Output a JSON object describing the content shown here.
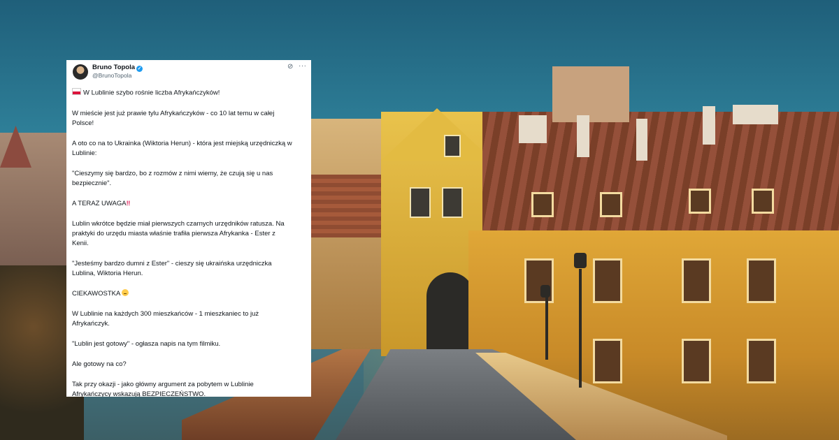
{
  "tweet": {
    "display_name": "Bruno Topola",
    "handle": "@BrunoTopola",
    "paragraphs": [
      "W Lublinie szybo rośnie liczba Afrykańczyków!",
      "W mieście jest już prawie tylu Afrykańczyków - co 10 lat temu w całej Polsce!",
      "A oto co na to Ukrainka (Wiktoria Herun) - która jest miejską urzędniczką w Lublinie:",
      "\"Cieszymy się bardzo, bo z rozmów z nimi wiemy, że czują się u nas bezpiecznie\".",
      "A TERAZ UWAGA",
      "Lublin wkrótce będzie miał pierwszych czarnych urzędników ratusza. Na praktyki do urzędu miasta właśnie trafiła pierwsza Afrykanka - Ester z Kenii.",
      "\"Jesteśmy bardzo dumni z Ester\" - cieszy się ukraińska urzędniczka Lublina, Wiktoria Herun.",
      "CIEKAWOSTKA",
      "W Lublinie na każdych 300 mieszkańców - 1 mieszkaniec to już Afrykańczyk.",
      "\"Lublin jest gotowy\" - ogłasza napis na tym filmiku.",
      "Ale gotowy na co?",
      "Tak przy okazji - jako główny argument za pobytem w Lublinie Afrykańczycy wskazują BEZPIECZEŃSTWO."
    ],
    "icons": {
      "verified": "verified-badge-icon",
      "grok": "grok-icon",
      "more": "more-options-icon",
      "flag": "poland-flag-icon",
      "alert": "double-exclamation-icon",
      "emoji": "thinking-face-icon"
    }
  },
  "colors": {
    "verified": "#1d9bf0",
    "text": "#0f1419",
    "secondary": "#536471",
    "card": "#ffffff"
  }
}
